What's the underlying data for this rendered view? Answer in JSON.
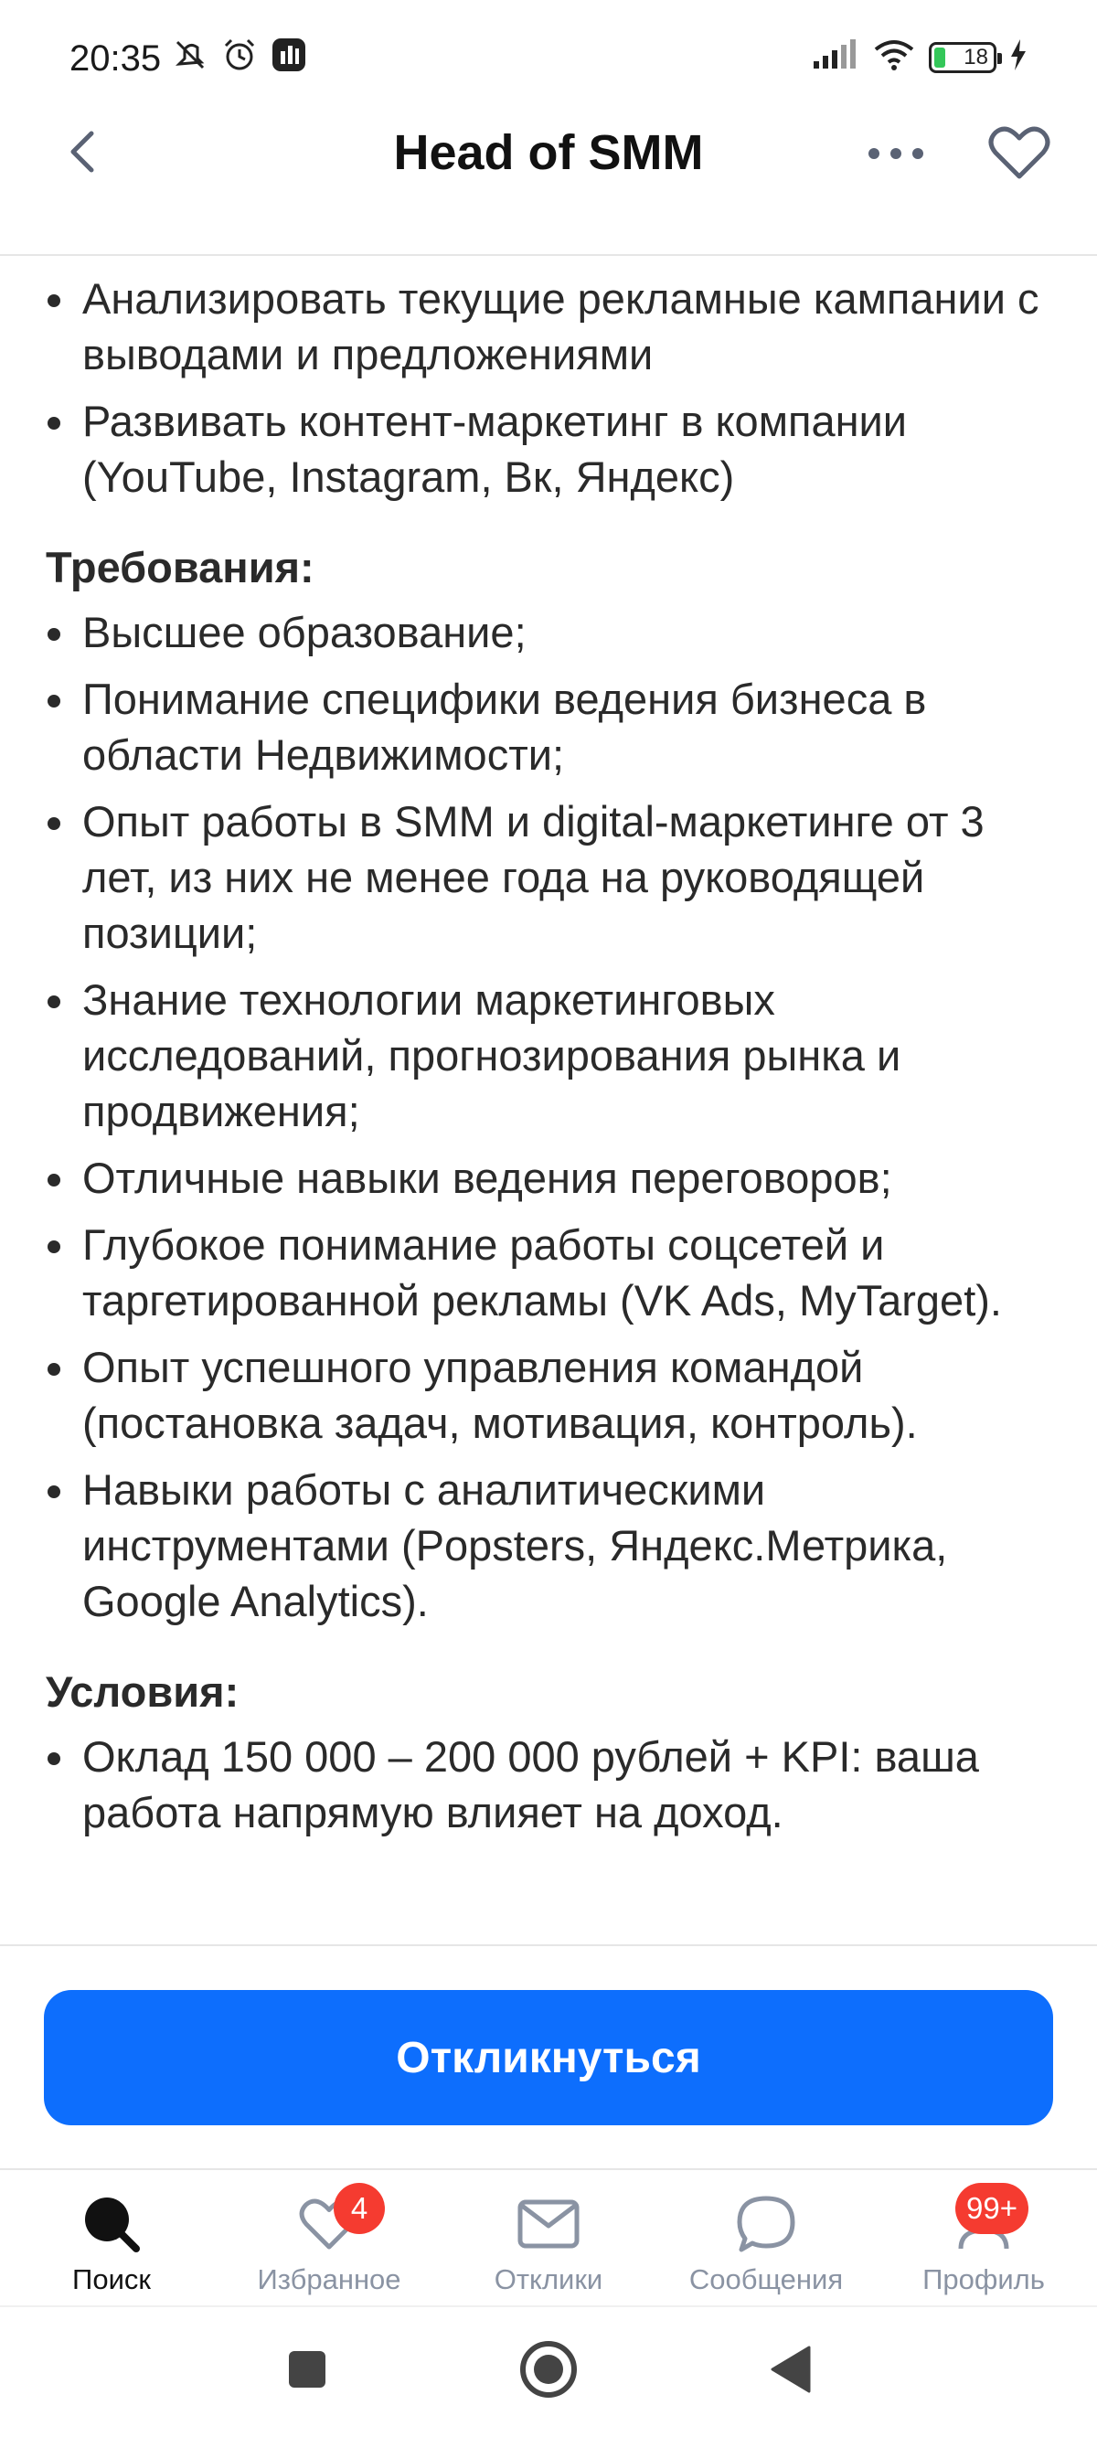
{
  "status_bar": {
    "time": "20:35",
    "battery": "18",
    "icons": [
      "mute-icon",
      "alarm-icon",
      "app-icon",
      "signal-icon",
      "wifi-icon",
      "battery-icon",
      "charging-icon"
    ]
  },
  "header": {
    "title": "Head of SMM"
  },
  "content": {
    "intro_items": [
      "Анализировать текущие рекламные кампании с выводами и предложениями",
      "Развивать контент-маркетинг в компании (YouTube, Instagram, Вк, Яндекс)"
    ],
    "requirements_title": "Требования:",
    "requirements": [
      "Высшее образование;",
      "Понимание специфики ведения бизнеса в области Недвижимости;",
      "Опыт работы в SMM и digital-маркетинге от 3 лет, из них не менее года на руководящей позиции;",
      "Знание технологии маркетинговых исследований, прогнозирования рынка и продвижения;",
      "Отличные навыки ведения переговоров;",
      "Глубокое понимание работы соцсетей и таргетированной рекламы (VK Ads, MyTarget).",
      "Опыт успешного управления командой (постановка задач, мотивация, контроль).",
      "Навыки работы с аналитическими инструментами (Popsters, Яндекс.Метрика, Google Analytics)."
    ],
    "conditions_title": "Условия:",
    "conditions": [
      "Оклад 150 000 – 200 000 рублей + KPI: ваша работа напрямую влияет на доход."
    ]
  },
  "cta": {
    "label": "Откликнуться"
  },
  "bottom_nav": {
    "items": [
      {
        "label": "Поиск",
        "icon": "search-icon"
      },
      {
        "label": "Избранное",
        "icon": "heart-icon",
        "badge": "4"
      },
      {
        "label": "Отклики",
        "icon": "mail-icon"
      },
      {
        "label": "Сообщения",
        "icon": "chat-icon"
      },
      {
        "label": "Профиль",
        "icon": "profile-icon",
        "badge": "99+"
      }
    ]
  },
  "colors": {
    "accent": "#0d6efd",
    "badge": "#f53b30",
    "nav_inactive": "#8a93a3"
  }
}
